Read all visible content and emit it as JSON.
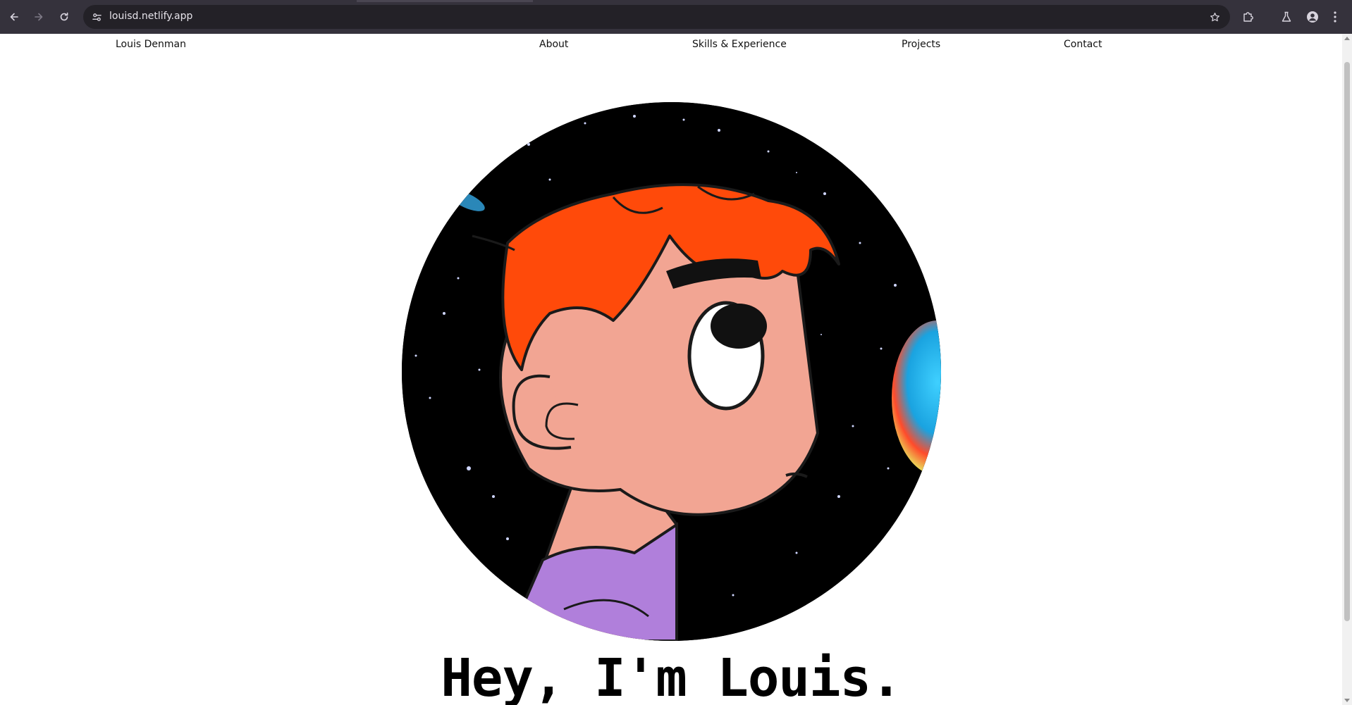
{
  "browser": {
    "url": "louisd.netlify.app",
    "icons": {
      "back": "back-arrow-icon",
      "forward": "forward-arrow-icon",
      "reload": "reload-icon",
      "site_info": "site-settings-icon",
      "bookmark": "star-icon",
      "extensions": "puzzle-icon",
      "labs": "flask-icon",
      "profile": "person-icon",
      "menu": "kebab-menu-icon"
    }
  },
  "site": {
    "brand": "Louis Denman",
    "nav": {
      "about": "About",
      "skills": "Skills & Experience",
      "projects": "Projects",
      "contact": "Contact"
    },
    "hero": {
      "heading": "Hey, I'm Louis.",
      "avatar_icon": "cartoon-avatar-portrait"
    }
  },
  "colors": {
    "chrome_bg": "#35323c",
    "omnibox_bg": "#232127",
    "hair": "#ff4a0a",
    "skin": "#f2a593",
    "shirt": "#b07fdb",
    "space": "#000000"
  }
}
